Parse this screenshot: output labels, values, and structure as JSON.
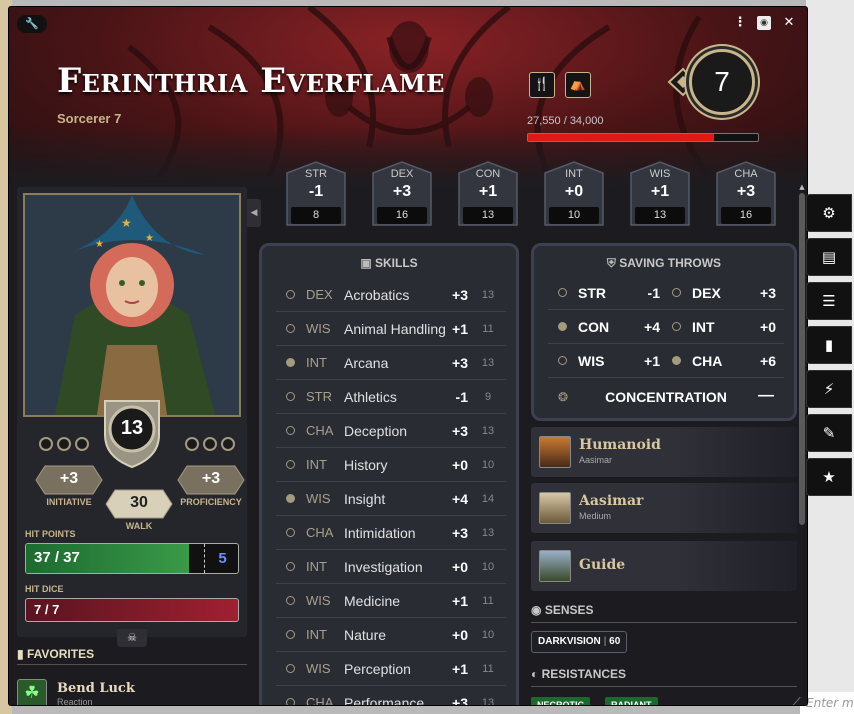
{
  "window": {
    "menu_icon": "⋮",
    "close_label": "✕"
  },
  "character": {
    "name": "Ferinthria Everflame",
    "class_level": "Sorcerer 7",
    "level": "7",
    "xp_text": "27,550 / 34,000",
    "xp_fraction": 0.81
  },
  "header_badges": [
    {
      "icon": "fork-knife-icon",
      "glyph": "🍴"
    },
    {
      "icon": "tent-icon",
      "glyph": "⛺"
    }
  ],
  "abilities": [
    {
      "name": "STR",
      "mod": "-1",
      "score": "8"
    },
    {
      "name": "DEX",
      "mod": "+3",
      "score": "16"
    },
    {
      "name": "CON",
      "mod": "+1",
      "score": "13"
    },
    {
      "name": "INT",
      "mod": "+0",
      "score": "10"
    },
    {
      "name": "WIS",
      "mod": "+1",
      "score": "13"
    },
    {
      "name": "CHA",
      "mod": "+3",
      "score": "16"
    }
  ],
  "combat": {
    "ac": "13",
    "initiative": "+3",
    "initiative_label": "INITIATIVE",
    "proficiency": "+3",
    "proficiency_label": "PROFICIENCY",
    "walk": "30",
    "walk_label": "WALK"
  },
  "hit_points": {
    "label": "HIT POINTS",
    "value": "37 / 37",
    "fraction": 1.0,
    "temp": "5"
  },
  "hit_dice": {
    "label": "HIT DICE",
    "value": "7 / 7"
  },
  "favorites": {
    "title": "FAVORITES",
    "items": [
      {
        "name": "Bend Luck",
        "sub": "Reaction"
      }
    ]
  },
  "skills": {
    "title": "SKILLS",
    "rows": [
      {
        "ability": "DEX",
        "name": "Acrobatics",
        "mod": "+3",
        "passive": "13",
        "proficient": false
      },
      {
        "ability": "WIS",
        "name": "Animal Handling",
        "mod": "+1",
        "passive": "11",
        "proficient": false
      },
      {
        "ability": "INT",
        "name": "Arcana",
        "mod": "+3",
        "passive": "13",
        "proficient": true
      },
      {
        "ability": "STR",
        "name": "Athletics",
        "mod": "-1",
        "passive": "9",
        "proficient": false
      },
      {
        "ability": "CHA",
        "name": "Deception",
        "mod": "+3",
        "passive": "13",
        "proficient": false
      },
      {
        "ability": "INT",
        "name": "History",
        "mod": "+0",
        "passive": "10",
        "proficient": false
      },
      {
        "ability": "WIS",
        "name": "Insight",
        "mod": "+4",
        "passive": "14",
        "proficient": true
      },
      {
        "ability": "CHA",
        "name": "Intimidation",
        "mod": "+3",
        "passive": "13",
        "proficient": false
      },
      {
        "ability": "INT",
        "name": "Investigation",
        "mod": "+0",
        "passive": "10",
        "proficient": false
      },
      {
        "ability": "WIS",
        "name": "Medicine",
        "mod": "+1",
        "passive": "11",
        "proficient": false
      },
      {
        "ability": "INT",
        "name": "Nature",
        "mod": "+0",
        "passive": "10",
        "proficient": false
      },
      {
        "ability": "WIS",
        "name": "Perception",
        "mod": "+1",
        "passive": "11",
        "proficient": false
      },
      {
        "ability": "CHA",
        "name": "Performance",
        "mod": "+3",
        "passive": "13",
        "proficient": false
      }
    ]
  },
  "saving_throws": {
    "title": "SAVING THROWS",
    "rows": [
      {
        "name": "STR",
        "mod": "-1",
        "proficient": false
      },
      {
        "name": "DEX",
        "mod": "+3",
        "proficient": false
      },
      {
        "name": "CON",
        "mod": "+4",
        "proficient": true
      },
      {
        "name": "INT",
        "mod": "+0",
        "proficient": false
      },
      {
        "name": "WIS",
        "mod": "+1",
        "proficient": false
      },
      {
        "name": "CHA",
        "mod": "+6",
        "proficient": true
      }
    ],
    "concentration_label": "CONCENTRATION",
    "concentration_value": "—"
  },
  "traits": [
    {
      "name": "Humanoid",
      "sub": "Aasimar"
    },
    {
      "name": "Aasimar",
      "sub": "Medium"
    },
    {
      "name": "Guide",
      "sub": ""
    }
  ],
  "senses": {
    "title": "SENSES",
    "items": [
      {
        "name": "DARKVISION",
        "value": "60"
      }
    ]
  },
  "resistances": {
    "title": "RESISTANCES",
    "items": [
      "NECROTIC",
      "RADIANT"
    ]
  },
  "side_tabs": [
    "gear-icon",
    "backpack-icon",
    "list-icon",
    "book-icon",
    "lightning-icon",
    "feather-icon",
    "star-icon"
  ],
  "chat": {
    "placeholder": "Enter m"
  },
  "colors": {
    "accent_gold": "#c8b68a",
    "xp_red": "#e01818",
    "hp_green": "#3a9a48",
    "hit_dice_red": "#a02030",
    "temp_blue": "#6c8cff"
  }
}
